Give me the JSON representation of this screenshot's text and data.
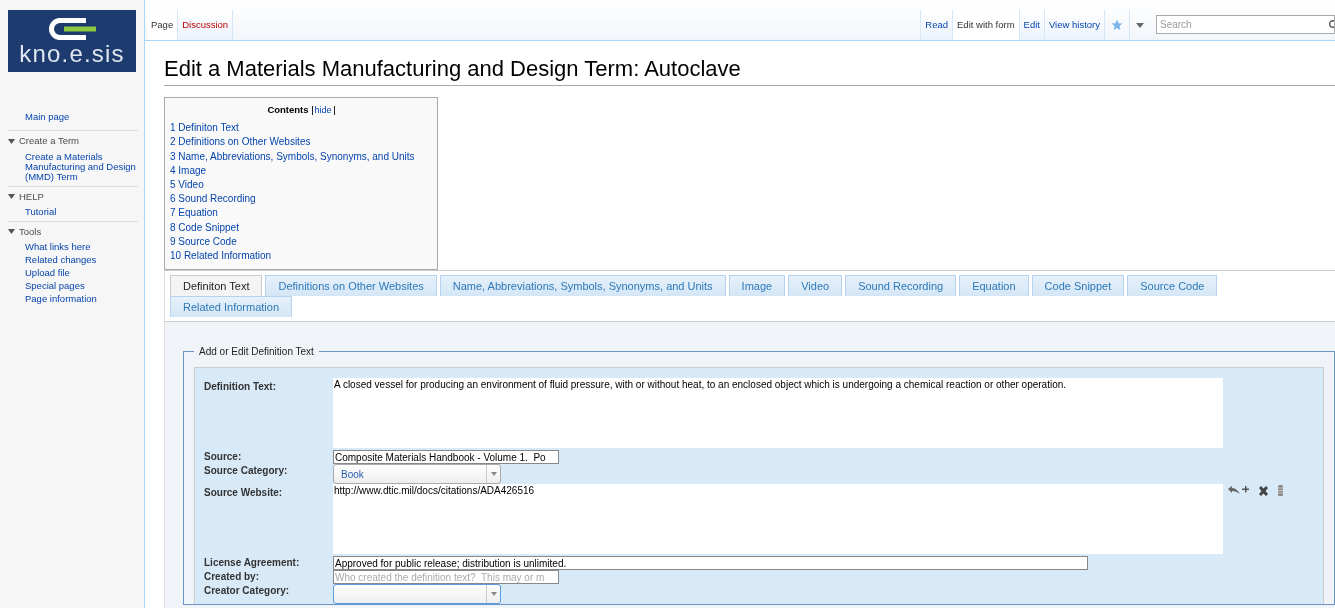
{
  "logo": {
    "text": "kno.e.sis"
  },
  "sidebar": {
    "main": "Main page",
    "sections": [
      {
        "title": "Create a Term",
        "expanded": true,
        "items": [
          "Create a Materials Manufacturing and Design (MMD) Term"
        ]
      },
      {
        "title": "HELP",
        "expanded": true,
        "items": [
          "Tutorial"
        ]
      },
      {
        "title": "Tools",
        "expanded": true,
        "items": [
          "What links here",
          "Related changes",
          "Upload file",
          "Special pages",
          "Page information"
        ]
      }
    ]
  },
  "namespace_tabs": [
    {
      "label": "Page",
      "selected": true
    },
    {
      "label": "Discussion",
      "selected": false
    }
  ],
  "view_tabs": [
    {
      "label": "Read",
      "selected": false
    },
    {
      "label": "Edit with form",
      "selected": true
    },
    {
      "label": "Edit",
      "selected": false
    },
    {
      "label": "View history",
      "selected": false
    }
  ],
  "search": {
    "placeholder": "Search"
  },
  "title": "Edit a Materials Manufacturing and Design Term: Autoclave",
  "toc": {
    "title": "Contents",
    "toggle": "hide",
    "items": [
      {
        "number": "1",
        "text": "Definiton Text"
      },
      {
        "number": "2",
        "text": "Definitions on Other Websites"
      },
      {
        "number": "3",
        "text": "Name, Abbreviations, Symbols, Synonyms, and Units"
      },
      {
        "number": "4",
        "text": "Image"
      },
      {
        "number": "5",
        "text": "Video"
      },
      {
        "number": "6",
        "text": "Sound Recording"
      },
      {
        "number": "7",
        "text": "Equation"
      },
      {
        "number": "8",
        "text": "Code Snippet"
      },
      {
        "number": "9",
        "text": "Source Code"
      },
      {
        "number": "10",
        "text": "Related Information"
      }
    ]
  },
  "form_tabs": [
    {
      "label": "Definiton Text",
      "selected": true
    },
    {
      "label": "Definitions on Other Websites",
      "selected": false
    },
    {
      "label": "Name, Abbreviations, Symbols, Synonyms, and Units",
      "selected": false
    },
    {
      "label": "Image",
      "selected": false
    },
    {
      "label": "Video",
      "selected": false
    },
    {
      "label": "Sound Recording",
      "selected": false
    },
    {
      "label": "Equation",
      "selected": false
    },
    {
      "label": "Code Snippet",
      "selected": false
    },
    {
      "label": "Source Code",
      "selected": false
    },
    {
      "label": "Related Information",
      "selected": false
    }
  ],
  "fieldset": {
    "legend": "Add or Edit Definition Text",
    "fields": [
      {
        "kind": "textarea",
        "label": "Definition Text:",
        "value": "A closed vessel for producing an environment of fluid pressure, with or without heat, to an enclosed object which is undergoing a chemical reaction or other operation."
      },
      {
        "kind": "input",
        "label": "Source:",
        "value": "Composite Materials Handbook - Volume 1.  Po"
      },
      {
        "kind": "select",
        "label": "Source Category:",
        "value": "Book",
        "focused": false
      },
      {
        "kind": "textarea",
        "label": "Source Website:",
        "value": "http://www.dtic.mil/docs/citations/ADA426516",
        "tools": true
      },
      {
        "kind": "wideinput",
        "label": "License Agreement:",
        "value": "Approved for public release; distribution is unlimited."
      },
      {
        "kind": "input",
        "label": "Created by:",
        "placeholder": "Who created the definition text?  This may or m"
      },
      {
        "kind": "select",
        "label": "Creator Category:",
        "focused": true
      }
    ]
  }
}
